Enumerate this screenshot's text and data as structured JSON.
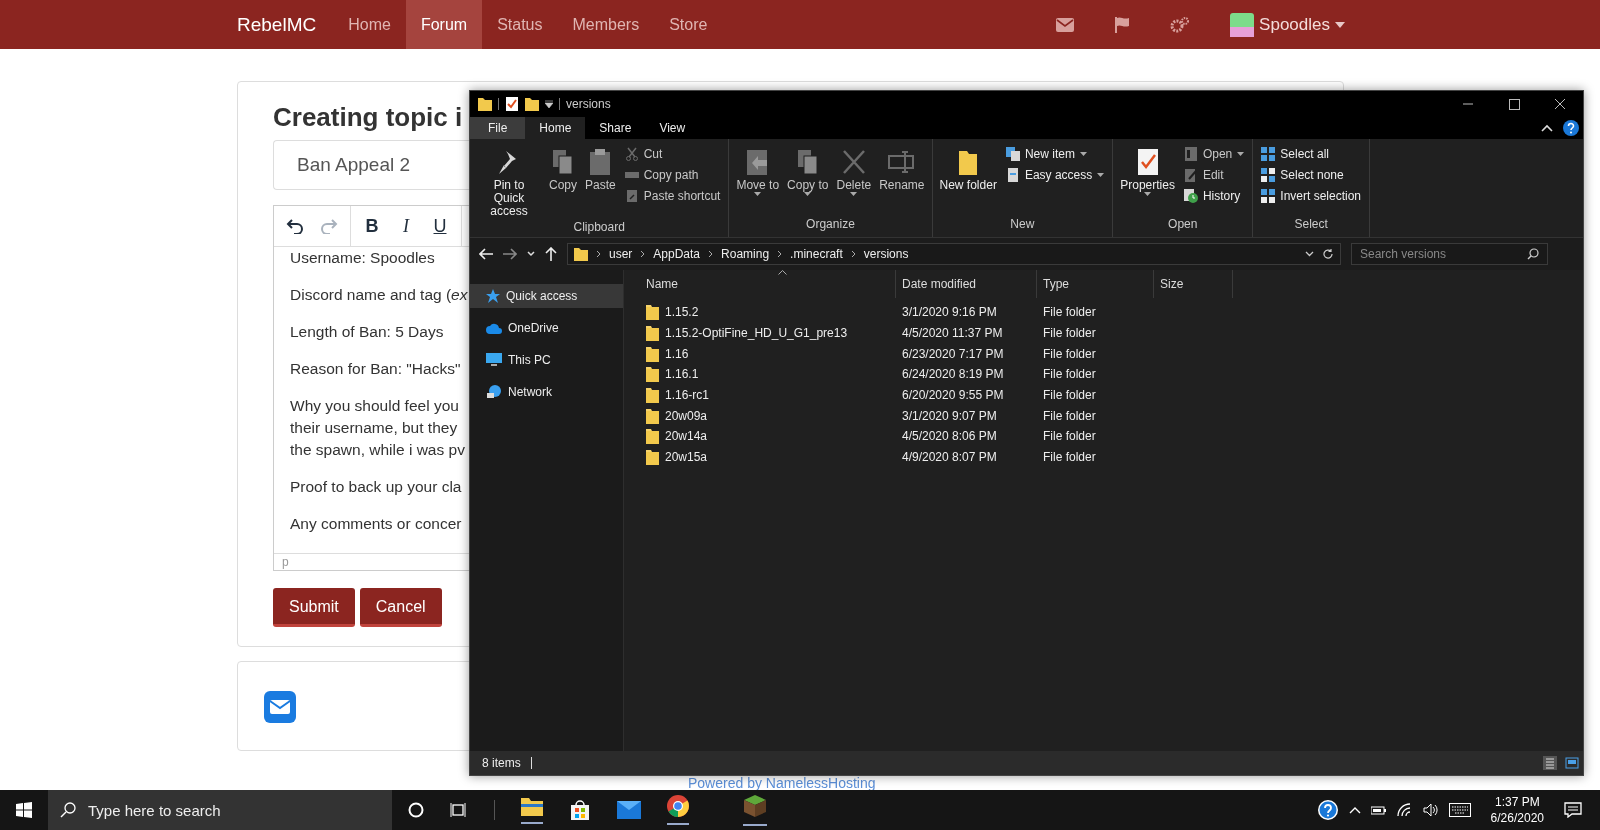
{
  "navbar": {
    "brand": "RebelMC",
    "links": [
      {
        "label": "Home",
        "selected": false
      },
      {
        "label": "Forum",
        "selected": true
      },
      {
        "label": "Status",
        "selected": false
      },
      {
        "label": "Members",
        "selected": false
      },
      {
        "label": "Store",
        "selected": false
      }
    ],
    "user": "Spoodles"
  },
  "topic_form": {
    "heading": "Creating topic i",
    "title_value": "Ban Appeal 2",
    "history_buttons": [
      {
        "disabled": false
      },
      {
        "disabled": true
      }
    ],
    "format_buttons": [
      "B",
      "I",
      "U"
    ],
    "paragraphs": [
      [
        "Username: Spoodles"
      ],
      [
        "Discord name and tag (*ex*"
      ],
      [
        "Length of Ban: 5 Days"
      ],
      [
        "Reason for Ban: \"Hacks\""
      ],
      [
        "Why you should feel you",
        "their username, but they",
        "the spawn, while i was pv"
      ],
      [
        "Proof to back up your cla"
      ],
      [
        "Any comments or concer"
      ]
    ],
    "element_path": "p",
    "buttons": [
      "Submit",
      "Cancel"
    ]
  },
  "footer": "Powered by NamelessHosting",
  "explorer": {
    "title": "versions",
    "tabs": [
      {
        "label": "File",
        "selected": false
      },
      {
        "label": "Home",
        "selected": true
      },
      {
        "label": "Share",
        "selected": false
      },
      {
        "label": "View",
        "selected": false
      }
    ],
    "groups": [
      {
        "label": "Clipboard",
        "items": [
          {
            "kind": "large",
            "label": "Pin to Quick access",
            "disabled": false,
            "dropdown": false
          },
          {
            "kind": "large",
            "label": "Copy",
            "disabled": true,
            "dropdown": false
          },
          {
            "kind": "large",
            "label": "Paste",
            "disabled": true,
            "dropdown": false
          },
          {
            "kind": "small",
            "label": "Cut",
            "disabled": true,
            "dropdown": false
          },
          {
            "kind": "small",
            "label": "Copy path",
            "disabled": true,
            "dropdown": false
          },
          {
            "kind": "small",
            "label": "Paste shortcut",
            "disabled": true,
            "dropdown": false
          }
        ]
      },
      {
        "label": "Organize",
        "items": [
          {
            "kind": "large",
            "label": "Move to",
            "disabled": true,
            "dropdown": true
          },
          {
            "kind": "large",
            "label": "Copy to",
            "disabled": true,
            "dropdown": true
          },
          {
            "kind": "large",
            "label": "Delete",
            "disabled": true,
            "dropdown": true
          },
          {
            "kind": "large",
            "label": "Rename",
            "disabled": true,
            "dropdown": false
          }
        ]
      },
      {
        "label": "New",
        "items": [
          {
            "kind": "large",
            "label": "New folder",
            "disabled": false,
            "dropdown": false
          },
          {
            "kind": "small",
            "label": "New item",
            "disabled": false,
            "dropdown": true
          },
          {
            "kind": "small",
            "label": "Easy access",
            "disabled": false,
            "dropdown": true
          }
        ]
      },
      {
        "label": "Open",
        "items": [
          {
            "kind": "large",
            "label": "Properties",
            "disabled": false,
            "dropdown": true
          },
          {
            "kind": "small",
            "label": "Open",
            "disabled": true,
            "dropdown": true
          },
          {
            "kind": "small",
            "label": "Edit",
            "disabled": true,
            "dropdown": false
          },
          {
            "kind": "small",
            "label": "History",
            "disabled": false,
            "dropdown": false
          }
        ]
      },
      {
        "label": "Select",
        "items": [
          {
            "kind": "small",
            "label": "Select all",
            "disabled": false,
            "dropdown": false
          },
          {
            "kind": "small",
            "label": "Select none",
            "disabled": false,
            "dropdown": false
          },
          {
            "kind": "small",
            "label": "Invert selection",
            "disabled": false,
            "dropdown": false
          }
        ]
      }
    ],
    "path": [
      "user",
      "AppData",
      "Roaming",
      ".minecraft",
      "versions"
    ],
    "search_placeholder": "Search versions",
    "nav": [
      {
        "label": "Quick access",
        "selected": true
      },
      {
        "label": "OneDrive",
        "selected": false
      },
      {
        "label": "This PC",
        "selected": false
      },
      {
        "label": "Network",
        "selected": false
      }
    ],
    "columns": [
      "Name",
      "Date modified",
      "Type",
      "Size"
    ],
    "files": [
      {
        "name": "1.15.2",
        "date": "3/1/2020 9:16 PM",
        "type": "File folder"
      },
      {
        "name": "1.15.2-OptiFine_HD_U_G1_pre13",
        "date": "4/5/2020 11:37 PM",
        "type": "File folder"
      },
      {
        "name": "1.16",
        "date": "6/23/2020 7:17 PM",
        "type": "File folder"
      },
      {
        "name": "1.16.1",
        "date": "6/24/2020 8:19 PM",
        "type": "File folder"
      },
      {
        "name": "1.16-rc1",
        "date": "6/20/2020 9:55 PM",
        "type": "File folder"
      },
      {
        "name": "20w09a",
        "date": "3/1/2020 9:07 PM",
        "type": "File folder"
      },
      {
        "name": "20w14a",
        "date": "4/5/2020 8:06 PM",
        "type": "File folder"
      },
      {
        "name": "20w15a",
        "date": "4/9/2020 8:07 PM",
        "type": "File folder"
      }
    ],
    "status": "8 items"
  },
  "taskbar": {
    "search_placeholder": "Type here to search",
    "time": "1:37 PM",
    "date": "6/26/2020"
  }
}
